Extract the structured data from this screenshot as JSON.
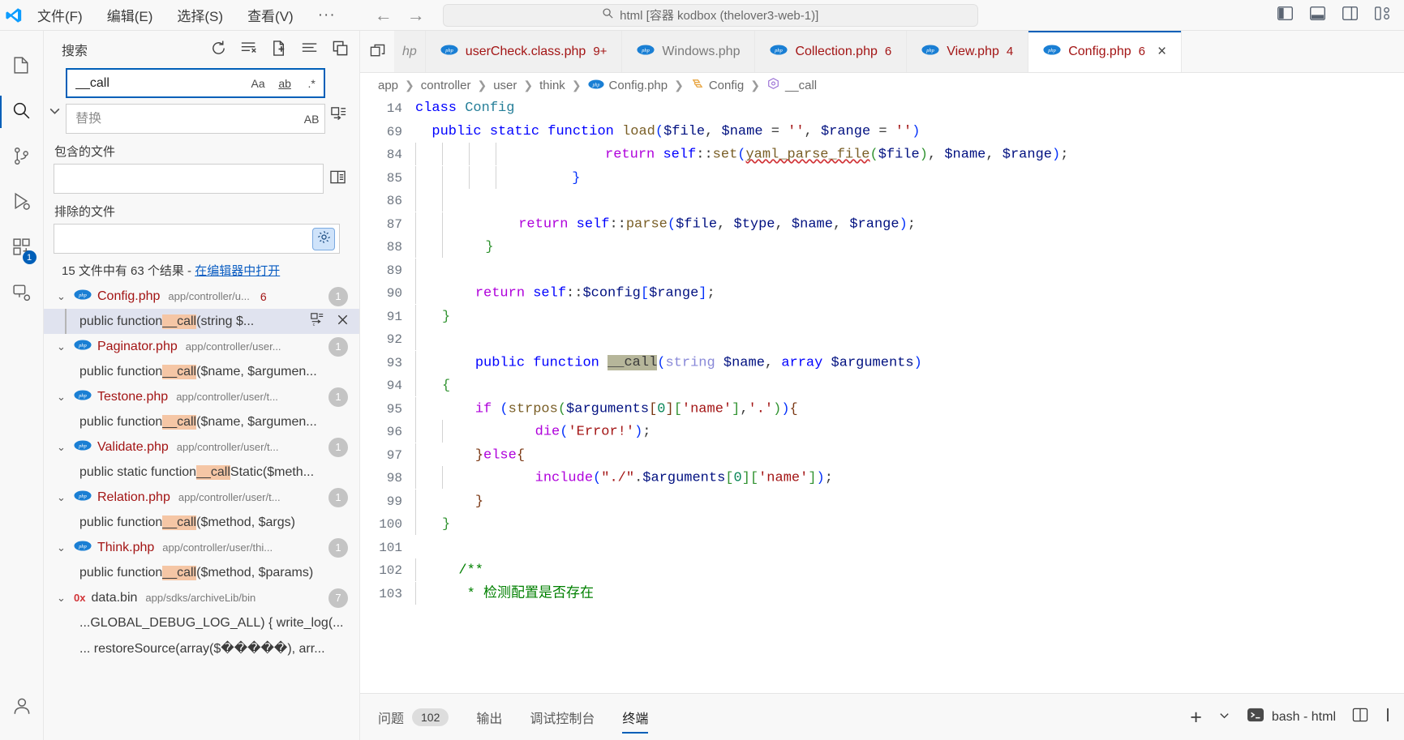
{
  "titlebar": {
    "logo": "vscode-logo",
    "menus": [
      "文件(F)",
      "编辑(E)",
      "选择(S)",
      "查看(V)",
      "···"
    ],
    "nav": {
      "back": "←",
      "forward": "→"
    },
    "command_center": {
      "icon": "search-icon",
      "text": "html [容器 kodbox (thelover3-web-1)]"
    },
    "layout_icons": [
      "toggle-primary-sidebar-icon",
      "toggle-panel-icon",
      "toggle-secondary-sidebar-icon",
      "customize-layout-icon"
    ]
  },
  "activitybar": {
    "items": [
      {
        "name": "explorer",
        "icon": "files-icon",
        "active": false,
        "badge": ""
      },
      {
        "name": "search",
        "icon": "search-icon",
        "active": true,
        "badge": ""
      },
      {
        "name": "source-control",
        "icon": "source-control-icon",
        "active": false,
        "badge": ""
      },
      {
        "name": "run-and-debug",
        "icon": "run-debug-icon",
        "active": false,
        "badge": ""
      },
      {
        "name": "extensions",
        "icon": "extensions-icon",
        "active": false,
        "badge": "1"
      },
      {
        "name": "remote-explorer",
        "icon": "remote-explorer-icon",
        "active": false,
        "badge": ""
      }
    ],
    "bottom": [
      {
        "name": "accounts",
        "icon": "account-icon"
      }
    ]
  },
  "sidebar": {
    "title": "搜索",
    "actions": [
      {
        "name": "refresh",
        "icon": "refresh-icon"
      },
      {
        "name": "clear-search-results",
        "icon": "clear-all-icon"
      },
      {
        "name": "open-new-search-editor",
        "icon": "new-search-editor-icon"
      },
      {
        "name": "view-as-list",
        "icon": "list-view-icon"
      },
      {
        "name": "collapse-all",
        "icon": "collapse-all-icon"
      }
    ],
    "toggle_replace": "chevron-down-icon",
    "search": {
      "value": "__call",
      "placeholder": "搜索",
      "options": [
        {
          "name": "match-case",
          "label": "Aa"
        },
        {
          "name": "match-whole-word",
          "label": "ab"
        },
        {
          "name": "use-regex",
          "label": ".*"
        }
      ]
    },
    "replace": {
      "value": "",
      "placeholder": "替换",
      "options": [
        {
          "name": "preserve-case",
          "label": "AB"
        },
        {
          "name": "replace-all",
          "icon": "replace-all-icon"
        }
      ]
    },
    "files_to_include": {
      "label": "包含的文件",
      "value": "",
      "placeholder": "",
      "action_icon": "open-editors-icon"
    },
    "files_to_exclude": {
      "label": "排除的文件",
      "value": "",
      "placeholder": "",
      "action_icon": "use-exclude-settings-icon"
    },
    "summary": {
      "text": "15 文件中有 63 个结果 - ",
      "link": "在编辑器中打开"
    },
    "results": [
      {
        "file": "Config.php",
        "path": "app/controller/u...",
        "count": "6",
        "badge": "1",
        "icon": "php-icon",
        "expanded": true,
        "selected_index": 0,
        "matches": [
          {
            "before": "public function ",
            "match": "__call",
            "after": "(string $...",
            "selected": true,
            "actions": [
              {
                "name": "replace-match",
                "icon": "replace-icon"
              },
              {
                "name": "dismiss-match",
                "icon": "close-icon"
              }
            ]
          }
        ]
      },
      {
        "file": "Paginator.php",
        "path": "app/controller/user...",
        "count": "",
        "badge": "1",
        "icon": "php-icon",
        "expanded": true,
        "matches": [
          {
            "before": "public function ",
            "match": "__call",
            "after": "($name, $argumen...",
            "selected": false,
            "actions": []
          }
        ]
      },
      {
        "file": "Testone.php",
        "path": "app/controller/user/t...",
        "count": "",
        "badge": "1",
        "icon": "php-icon",
        "expanded": true,
        "matches": [
          {
            "before": "public function ",
            "match": "__call",
            "after": "($name, $argumen...",
            "selected": false,
            "actions": []
          }
        ]
      },
      {
        "file": "Validate.php",
        "path": "app/controller/user/t...",
        "count": "",
        "badge": "1",
        "icon": "php-icon",
        "expanded": true,
        "matches": [
          {
            "before": "public static function ",
            "match": "__call",
            "after": "Static($meth...",
            "selected": false,
            "actions": []
          }
        ]
      },
      {
        "file": "Relation.php",
        "path": "app/controller/user/t...",
        "count": "",
        "badge": "1",
        "icon": "php-icon",
        "expanded": true,
        "matches": [
          {
            "before": "public function ",
            "match": "__call",
            "after": "($method, $args)",
            "selected": false,
            "actions": []
          }
        ]
      },
      {
        "file": "Think.php",
        "path": "app/controller/user/thi...",
        "count": "",
        "badge": "1",
        "icon": "php-icon",
        "expanded": true,
        "matches": [
          {
            "before": "public function ",
            "match": "__call",
            "after": "($method, $params)",
            "selected": false,
            "actions": []
          }
        ]
      },
      {
        "file": "data.bin",
        "path": "app/sdks/archiveLib/bin",
        "count": "",
        "badge": "7",
        "icon": "binary-icon",
        "expanded": true,
        "matches": [
          {
            "before": "...GLOBAL_DEBUG_LOG_ALL) { write_log(...",
            "match": "",
            "after": "",
            "selected": false,
            "actions": []
          },
          {
            "before": "... restoreSource(array($�����), arr...",
            "match": "",
            "after": "",
            "selected": false,
            "actions": []
          }
        ]
      }
    ]
  },
  "editor": {
    "tabs": [
      {
        "label": "hp",
        "icon": "",
        "count": "",
        "active": false,
        "partial": true,
        "modified": false
      },
      {
        "label": "userCheck.class.php",
        "icon": "php-icon",
        "count": "9+",
        "active": false,
        "partial": false,
        "modified": true
      },
      {
        "label": "Windows.php",
        "icon": "php-icon",
        "count": "",
        "active": false,
        "partial": false,
        "modified": false
      },
      {
        "label": "Collection.php",
        "icon": "php-icon",
        "count": "6",
        "active": false,
        "partial": false,
        "modified": true
      },
      {
        "label": "View.php",
        "icon": "php-icon",
        "count": "4",
        "active": false,
        "partial": false,
        "modified": true
      },
      {
        "label": "Config.php",
        "icon": "php-icon",
        "count": "6",
        "active": true,
        "partial": false,
        "modified": true,
        "close": "×"
      }
    ],
    "tabbar_icon": "split-editor-icon",
    "breadcrumb": [
      {
        "label": "app",
        "icon": ""
      },
      {
        "label": "controller",
        "icon": ""
      },
      {
        "label": "user",
        "icon": ""
      },
      {
        "label": "think",
        "icon": ""
      },
      {
        "label": "Config.php",
        "icon": "php-icon"
      },
      {
        "label": "Config",
        "icon": "symbol-class-icon"
      },
      {
        "label": "__call",
        "icon": "symbol-method-icon"
      }
    ],
    "lines": [
      {
        "n": "14",
        "indent": 0,
        "html": "<span class=\"k\">class</span> <span class=\"cls\">Config</span>"
      },
      {
        "n": "69",
        "indent": 0,
        "html": "  <span class=\"k\">public</span> <span class=\"k\">static</span> <span class=\"k\">function</span> <span class=\"fn\">load</span><span class=\"br1\">(</span><span class=\"var\">$file</span>, <span class=\"var\">$name</span> = <span class=\"str\">''</span>, <span class=\"var\">$range</span> = <span class=\"str\">''</span><span class=\"br1\">)</span>"
      },
      {
        "n": "84",
        "indent": 4,
        "html": "          <span class=\"kp\">return</span> <span class=\"k\">self</span>::<span class=\"fn\">set</span><span class=\"br1\">(</span><span class=\"fn squig\">yaml_parse_file</span><span class=\"br2\">(</span><span class=\"var\">$file</span><span class=\"br2\">)</span>, <span class=\"var\">$name</span>, <span class=\"var\">$range</span><span class=\"br1\">)</span>;"
      },
      {
        "n": "85",
        "indent": 4,
        "html": "      <span class=\"br1\">}</span>"
      },
      {
        "n": "86",
        "indent": 2,
        "html": ""
      },
      {
        "n": "87",
        "indent": 2,
        "html": "      <span class=\"kp\">return</span> <span class=\"k\">self</span>::<span class=\"fn\">parse</span><span class=\"br1\">(</span><span class=\"var\">$file</span>, <span class=\"var\">$type</span>, <span class=\"var\">$name</span>, <span class=\"var\">$range</span><span class=\"br1\">)</span>;"
      },
      {
        "n": "88",
        "indent": 2,
        "html": "  <span class=\"br2\">}</span>"
      },
      {
        "n": "89",
        "indent": 1,
        "html": ""
      },
      {
        "n": "90",
        "indent": 1,
        "html": "    <span class=\"kp\">return</span> <span class=\"k\">self</span>::<span class=\"var\">$config</span><span class=\"br1\">[</span><span class=\"var\">$range</span><span class=\"br1\">]</span>;"
      },
      {
        "n": "91",
        "indent": 1,
        "html": "<span class=\"br2\">}</span>"
      },
      {
        "n": "92",
        "indent": 1,
        "html": ""
      },
      {
        "n": "93",
        "indent": 1,
        "html": "    <span class=\"k\">public</span> <span class=\"k\">function</span> <span class=\"hlword\">__call</span><span class=\"br1\">(</span><span class=\"type\">string</span> <span class=\"var\">$name</span>, <span class=\"k\">array</span> <span class=\"var\">$arguments</span><span class=\"br1\">)</span>"
      },
      {
        "n": "94",
        "indent": 1,
        "html": "<span class=\"br2\">{</span>"
      },
      {
        "n": "95",
        "indent": 1,
        "html": "    <span class=\"kp\">if</span> <span class=\"br1\">(</span><span class=\"fn\">strpos</span><span class=\"br2\">(</span><span class=\"var\">$arguments</span><span class=\"br3\">[</span><span class=\"num\">0</span><span class=\"br3\">]</span><span class=\"br2\">[</span><span class=\"str\">'name'</span><span class=\"br2\">]</span>,<span class=\"str\">'.'</span><span class=\"br2\">)</span><span class=\"br1\">)</span><span class=\"br3\">{</span>"
      },
      {
        "n": "96",
        "indent": 2,
        "html": "        <span class=\"kp\">die</span><span class=\"br1\">(</span><span class=\"str\">'Error!'</span><span class=\"br1\">)</span>;"
      },
      {
        "n": "97",
        "indent": 1,
        "html": "    <span class=\"br3\">}</span><span class=\"kp\">else</span><span class=\"br3\">{</span>"
      },
      {
        "n": "98",
        "indent": 2,
        "html": "        <span class=\"kp\">include</span><span class=\"br1\">(</span><span class=\"str\">\"./\"</span>.<span class=\"var\">$arguments</span><span class=\"br2\">[</span><span class=\"num\">0</span><span class=\"br2\">]</span><span class=\"br2\">[</span><span class=\"str\">'name'</span><span class=\"br2\">]</span><span class=\"br1\">)</span>;"
      },
      {
        "n": "99",
        "indent": 1,
        "html": "    <span class=\"br3\">}</span>"
      },
      {
        "n": "100",
        "indent": 1,
        "html": "<span class=\"br2\">}</span>"
      },
      {
        "n": "101",
        "indent": 0,
        "html": ""
      },
      {
        "n": "102",
        "indent": 1,
        "html": "  <span class=\"cm\">/**</span>"
      },
      {
        "n": "103",
        "indent": 1,
        "html": "   <span class=\"cm\">* 检测配置是否存在</span>"
      }
    ]
  },
  "panel": {
    "tabs": [
      {
        "label": "问题",
        "badge": "102",
        "active": false
      },
      {
        "label": "输出",
        "badge": "",
        "active": false
      },
      {
        "label": "调试控制台",
        "badge": "",
        "active": false
      },
      {
        "label": "终端",
        "badge": "",
        "active": true
      }
    ],
    "actions": {
      "new_terminal": "+",
      "new_terminal_dropdown": "chevron-down-icon",
      "terminal_name": "bash - html",
      "terminal_icon": "terminal-bash-icon",
      "split": "split-terminal-icon",
      "more": "more-actions-icon"
    }
  }
}
